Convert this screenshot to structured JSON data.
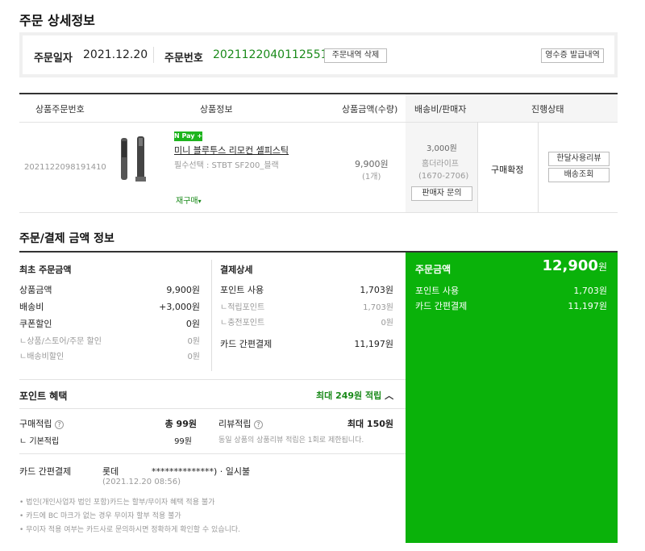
{
  "page_title": "주문 상세정보",
  "order": {
    "date_label": "주문일자",
    "date": "2021.12.20",
    "number_label": "주문번호",
    "number": "2021122040112551",
    "delete_btn": "주문내역 삭제",
    "receipt_btn": "영수증 발급내역"
  },
  "table": {
    "headers": [
      "상품주문번호",
      "상품정보",
      "상품금액(수량)",
      "배송비/판매자",
      "진행상태"
    ],
    "row": {
      "order_no": "2021122098191410",
      "npay_badge": "N Pay +",
      "product_name": "미니 블루투스 리모컨 셀피스틱",
      "option": "필수선택 : STBT SF200_블랙",
      "rebuy": "재구매",
      "price": "9,900원",
      "qty": "(1개)",
      "shipping_fee": "3,000원",
      "seller": "홈더라이프",
      "seller_phone": "(1670-2706)",
      "seller_inquiry_btn": "판매자 문의",
      "status": "구매확정",
      "review_btn": "한달사용리뷰",
      "track_btn": "배송조회"
    }
  },
  "payment_title": "주문/결제 금액 정보",
  "initial": {
    "title": "최초 주문금액",
    "items": [
      {
        "label": "상품금액",
        "value": "9,900원"
      },
      {
        "label": "배송비",
        "value": "+3,000원"
      },
      {
        "label": "쿠폰할인",
        "value": "0원"
      },
      {
        "label": "ㄴ상품/스토어/주문 할인",
        "value": "0원"
      },
      {
        "label": "ㄴ배송비할인",
        "value": "0원"
      }
    ]
  },
  "detail": {
    "title": "결제상세",
    "items": [
      {
        "label": "포인트 사용",
        "value": "1,703원"
      },
      {
        "label": "ㄴ적립포인트",
        "value": "1,703원"
      },
      {
        "label": "ㄴ충전포인트",
        "value": "0원"
      },
      {
        "label": "카드 간편결제",
        "value": "11,197원"
      }
    ]
  },
  "summary": {
    "total_label": "주문금액",
    "total_value": "12,900",
    "total_unit": "원",
    "point_label": "포인트 사용",
    "point_value": "1,703원",
    "card_label": "카드 간편결제",
    "card_value": "11,197원"
  },
  "benefit": {
    "title": "포인트 혜택",
    "max_label": "최대 249원 적립",
    "purchase_label": "구매적립",
    "purchase_total": "총 99원",
    "basic_label": "ㄴ 기본적립",
    "basic_value": "99원",
    "review_label": "리뷰적립",
    "review_value": "최대 150원",
    "review_note": "동일 상품의 상품리뷰 적립은 1회로 제한됩니다."
  },
  "card": {
    "label": "카드 간편결제",
    "card_name": "롯데",
    "card_masked": "**************) · 일시불",
    "card_datetime": "(2021.12.20 08:56)"
  },
  "notes": [
    "• 법인(개인사업자 법인 포함)카드는 할부/무이자 혜택 적용 불가",
    "• 카드에 BC 마크가 없는 경우 무이자 할부 적용 불가",
    "• 무이자 적용 여부는 카드사로 문의하시면 정확하게 확인할 수 있습니다."
  ]
}
